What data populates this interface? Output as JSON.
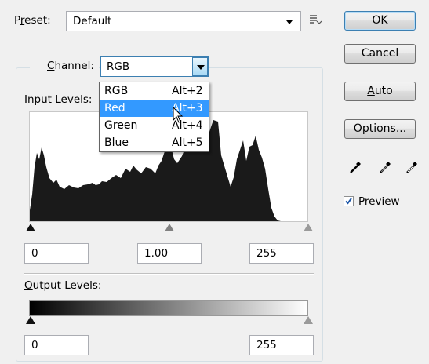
{
  "preset": {
    "label_pre": "P",
    "label_ul": "r",
    "label_post": "eset:",
    "value": "Default"
  },
  "buttons": {
    "ok": "OK",
    "cancel": "Cancel",
    "auto_ul": "A",
    "auto_rest": "uto",
    "options_pre": "Opt",
    "options_ul": "i",
    "options_post": "ons..."
  },
  "channel": {
    "label_ul": "C",
    "label_rest": "hannel:",
    "value": "RGB"
  },
  "channel_options": [
    {
      "name": "RGB",
      "shortcut": "Alt+2"
    },
    {
      "name": "Red",
      "shortcut": "Alt+3"
    },
    {
      "name": "Green",
      "shortcut": "Alt+4"
    },
    {
      "name": "Blue",
      "shortcut": "Alt+5"
    }
  ],
  "selected_channel_index": 1,
  "input_levels": {
    "label_ul": "I",
    "label_rest": "nput Levels:",
    "black": "0",
    "gamma": "1.00",
    "white": "255"
  },
  "output_levels": {
    "label_ul": "O",
    "label_rest": "utput Levels:",
    "black": "0",
    "white": "255"
  },
  "preview": {
    "label_ul": "P",
    "label_rest": "review",
    "checked": true
  },
  "icons": [
    "preset-menu-icon",
    "dropdown-arrow-icon",
    "black-eyedropper-icon",
    "gray-eyedropper-icon",
    "white-eyedropper-icon",
    "checkmark-icon"
  ],
  "colors": {
    "accent": "#3399ff",
    "histogram": "#1a1a1a",
    "default_button_border": "#3c7fb1"
  }
}
